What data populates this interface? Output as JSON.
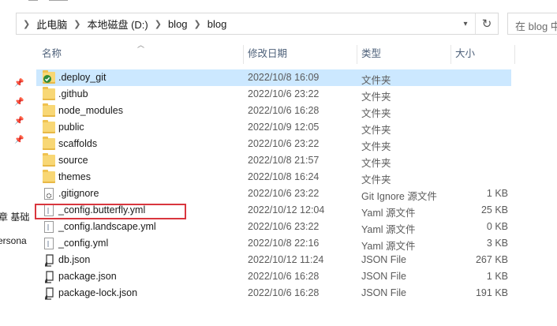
{
  "ribbon": {
    "left_text": "—",
    "right_text": "——"
  },
  "breadcrumb": {
    "items": [
      "此电脑",
      "本地磁盘 (D:)",
      "blog",
      "blog"
    ]
  },
  "search": {
    "placeholder": "在 blog 中"
  },
  "nav_pane": {
    "fragment_1": "章 基础",
    "fragment_2": "ersona"
  },
  "columns": {
    "name": "名称",
    "date": "修改日期",
    "type": "类型",
    "size": "大小"
  },
  "files": [
    {
      "name": ".deploy_git",
      "date": "2022/10/8 16:09",
      "type": "文件夹",
      "size": "",
      "icon": "folder-sync-icon",
      "selected": true
    },
    {
      "name": ".github",
      "date": "2022/10/6 23:22",
      "type": "文件夹",
      "size": "",
      "icon": "folder-icon"
    },
    {
      "name": "node_modules",
      "date": "2022/10/6 16:28",
      "type": "文件夹",
      "size": "",
      "icon": "folder-icon"
    },
    {
      "name": "public",
      "date": "2022/10/9 12:05",
      "type": "文件夹",
      "size": "",
      "icon": "folder-icon"
    },
    {
      "name": "scaffolds",
      "date": "2022/10/6 23:22",
      "type": "文件夹",
      "size": "",
      "icon": "folder-icon"
    },
    {
      "name": "source",
      "date": "2022/10/8 21:57",
      "type": "文件夹",
      "size": "",
      "icon": "folder-icon"
    },
    {
      "name": "themes",
      "date": "2022/10/8 16:24",
      "type": "文件夹",
      "size": "",
      "icon": "folder-icon"
    },
    {
      "name": ".gitignore",
      "date": "2022/10/6 23:22",
      "type": "Git Ignore 源文件",
      "size": "1 KB",
      "icon": "gear-file-icon"
    },
    {
      "name": "_config.butterfly.yml",
      "date": "2022/10/12 12:04",
      "type": "Yaml 源文件",
      "size": "25 KB",
      "icon": "file-icon",
      "highlighted": true
    },
    {
      "name": "_config.landscape.yml",
      "date": "2022/10/6 23:22",
      "type": "Yaml 源文件",
      "size": "0 KB",
      "icon": "file-icon"
    },
    {
      "name": "_config.yml",
      "date": "2022/10/8 22:16",
      "type": "Yaml 源文件",
      "size": "3 KB",
      "icon": "file-icon"
    },
    {
      "name": "db.json",
      "date": "2022/10/12 11:24",
      "type": "JSON File",
      "size": "267 KB",
      "icon": "json-file-icon"
    },
    {
      "name": "package.json",
      "date": "2022/10/6 16:28",
      "type": "JSON File",
      "size": "1 KB",
      "icon": "json-file-icon"
    },
    {
      "name": "package-lock.json",
      "date": "2022/10/6 16:28",
      "type": "JSON File",
      "size": "191 KB",
      "icon": "json-file-icon"
    }
  ],
  "colors": {
    "selection": "#cce8ff",
    "highlight_box": "#d9363e",
    "folder": "#f8d775",
    "header_text": "#4d6079"
  }
}
